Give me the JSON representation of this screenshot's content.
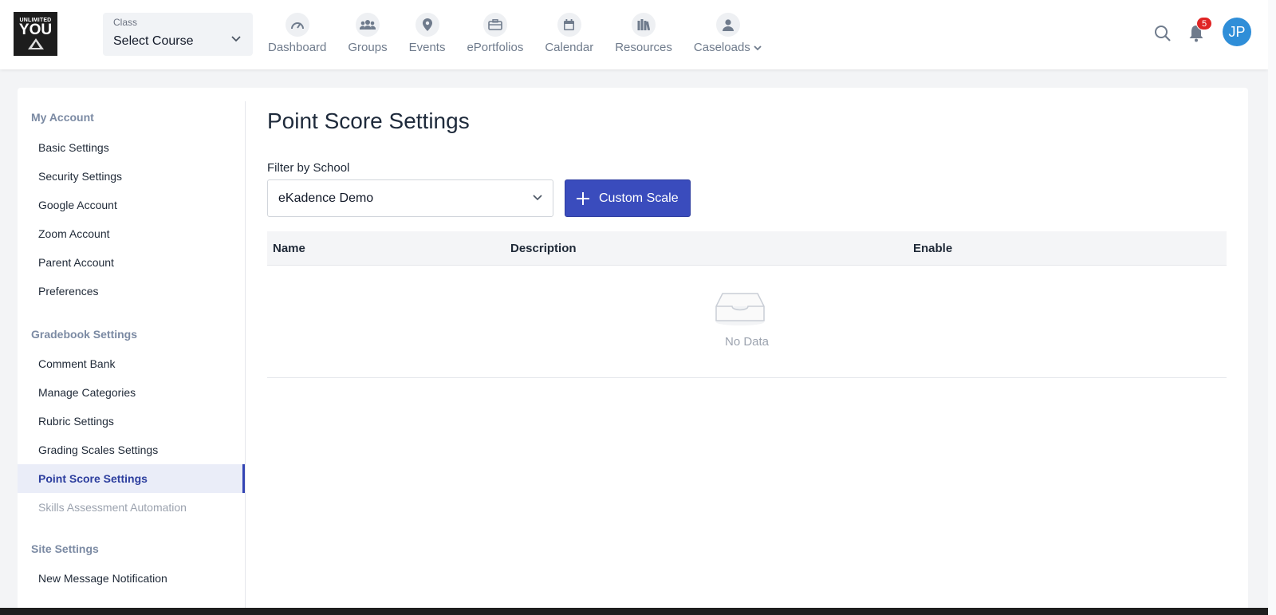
{
  "header": {
    "logo": {
      "line1": "UNLIMITED",
      "line2": "YOU"
    },
    "class_select": {
      "label": "Class",
      "value": "Select Course"
    },
    "nav": [
      {
        "label": "Dashboard",
        "icon": "dashboard-gauge-icon"
      },
      {
        "label": "Groups",
        "icon": "groups-icon"
      },
      {
        "label": "Events",
        "icon": "location-pin-icon"
      },
      {
        "label": "ePortfolios",
        "icon": "briefcase-icon"
      },
      {
        "label": "Calendar",
        "icon": "calendar-icon"
      },
      {
        "label": "Resources",
        "icon": "books-icon"
      },
      {
        "label": "Caseloads",
        "icon": "user-icon"
      }
    ],
    "notification_count": "5",
    "avatar_initials": "JP"
  },
  "sidebar": {
    "sections": [
      {
        "title": "My Account",
        "items": [
          "Basic Settings",
          "Security Settings",
          "Google Account",
          "Zoom Account",
          "Parent Account",
          "Preferences"
        ]
      },
      {
        "title": "Gradebook Settings",
        "items": [
          "Comment Bank",
          "Manage Categories",
          "Rubric Settings",
          "Grading Scales Settings",
          "Point Score Settings",
          "Skills Assessment Automation"
        ]
      },
      {
        "title": "Site Settings",
        "items": [
          "New Message Notification"
        ]
      }
    ],
    "active_item": "Point Score Settings"
  },
  "main": {
    "title": "Point Score Settings",
    "filter_label": "Filter by School",
    "school_value": "eKadence Demo",
    "custom_button": "Custom Scale",
    "table": {
      "columns": [
        "Name",
        "Description",
        "Enable"
      ],
      "empty_text": "No Data"
    }
  },
  "colors": {
    "accent": "#3a4cbd",
    "badge": "#e02424",
    "avatar": "#2f8ed8"
  }
}
